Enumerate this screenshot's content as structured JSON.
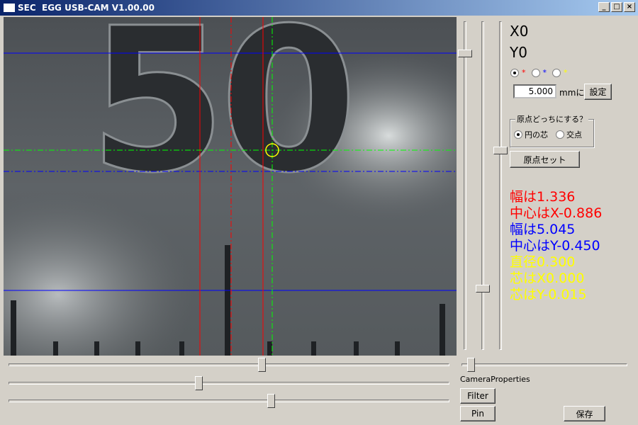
{
  "window": {
    "title": "SEC  EGG USB-CAM V1.00.00",
    "controls": [
      "_",
      "□",
      "×"
    ]
  },
  "readout": {
    "x": "X0",
    "y": "Y0"
  },
  "color_radios": {
    "items": [
      {
        "symbol": "*",
        "color": "#ff0000",
        "checked": true
      },
      {
        "symbol": "*",
        "color": "#0000ff",
        "checked": false
      },
      {
        "symbol": "*",
        "color": "#ffff00",
        "checked": false
      }
    ]
  },
  "scale": {
    "value": "5.000",
    "unit": "mmに",
    "set_label": "設定"
  },
  "origin": {
    "group_label": "原点どっちにする？",
    "option_circle": "円の芯",
    "option_cross": "交点",
    "set_button": "原点セット"
  },
  "results": {
    "width_x": "幅は1.336",
    "center_x": "中心はX-0.886",
    "width_y": "幅は5.045",
    "center_y": "中心はY-0.450",
    "diameter": "直径0.300",
    "core_x": "芯はX0.000",
    "core_y": "芯はY-0.015",
    "colors": {
      "red": "#ff0000",
      "blue": "#0000ff",
      "yellow": "#ffff00"
    }
  },
  "bottom": {
    "camera_properties": "CameraProperties",
    "filter_label": "Filter",
    "pin_label": "Pin",
    "save_label": "保存"
  },
  "video": {
    "digits": "50"
  }
}
